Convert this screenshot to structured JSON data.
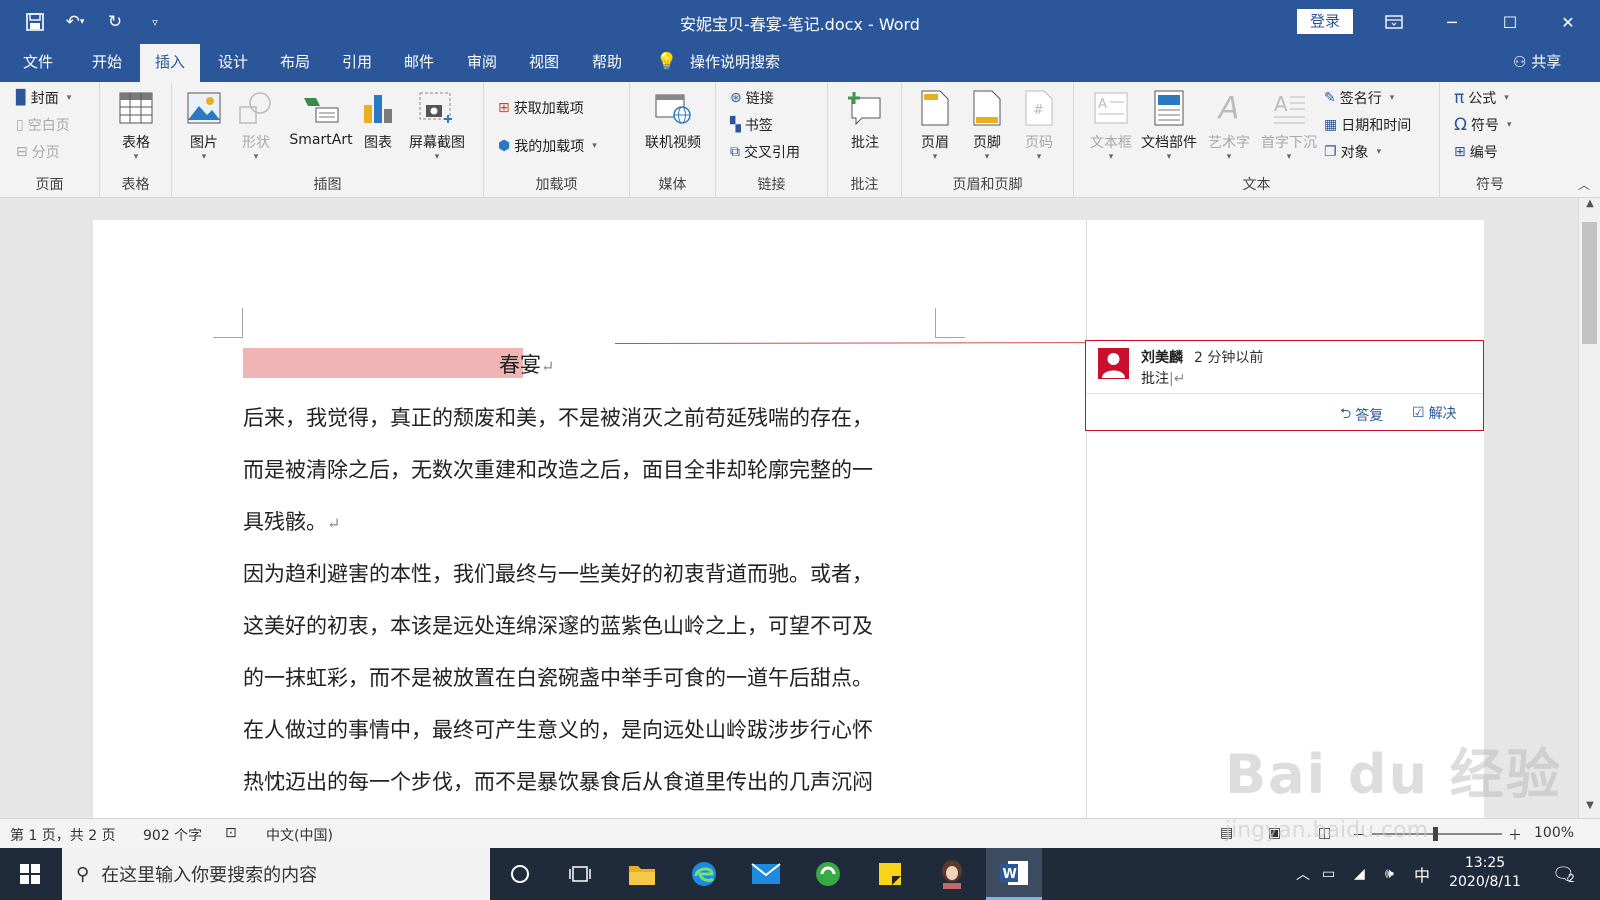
{
  "window": {
    "title": "安妮宝贝-春宴-笔记.docx  -  Word",
    "login_label": "登录"
  },
  "menu": {
    "tabs": [
      "文件",
      "开始",
      "插入",
      "设计",
      "布局",
      "引用",
      "邮件",
      "审阅",
      "视图",
      "帮助"
    ],
    "active_tab": "插入",
    "tell_me": "操作说明搜索",
    "share": "共享"
  },
  "ribbon": {
    "page": {
      "label": "页面",
      "cover": "封面",
      "blank": "空白页",
      "break": "分页"
    },
    "table": {
      "label": "表格",
      "table": "表格"
    },
    "illustrations": {
      "label": "插图",
      "picture": "图片",
      "shapes": "形状",
      "smartart": "SmartArt",
      "chart": "图表",
      "screenshot": "屏幕截图"
    },
    "addins": {
      "label": "加载项",
      "get": "获取加载项",
      "mine": "我的加载项"
    },
    "media": {
      "label": "媒体",
      "online_video": "联机视频"
    },
    "links": {
      "label": "链接",
      "link": "链接",
      "bookmark": "书签",
      "crossref": "交叉引用"
    },
    "comments": {
      "label": "批注",
      "comment": "批注"
    },
    "header_footer": {
      "label": "页眉和页脚",
      "header": "页眉",
      "footer": "页脚",
      "page_number": "页码"
    },
    "text": {
      "label": "文本",
      "textbox": "文本框",
      "quickparts": "文档部件",
      "wordart": "艺术字",
      "dropcap": "首字下沉",
      "signature": "签名行",
      "datetime": "日期和时间",
      "object": "对象"
    },
    "symbols": {
      "label": "符号",
      "equation": "公式",
      "symbol": "符号",
      "number": "编号"
    }
  },
  "document": {
    "title": "春宴",
    "lines": [
      "后来，我觉得，真正的颓废和美，不是被消灭之前苟延残喘的存在，",
      "而是被清除之后，无数次重建和改造之后，面目全非却轮廓完整的一",
      "具残骸。",
      "因为趋利避害的本性，我们最终与一些美好的初衷背道而驰。或者，",
      "这美好的初衷，本该是远处连绵深邃的蓝紫色山岭之上，可望不可及",
      "的一抹虹彩，而不是被放置在白瓷碗盏中举手可食的一道午后甜点。",
      "在人做过的事情中，最终可产生意义的，是向远处山岭跋涉步行心怀",
      "热忱迈出的每一个步伐，而不是暴饮暴食后从食道里传出的几声沉闷"
    ]
  },
  "comment": {
    "author": "刘美麟",
    "time": "2 分钟以前",
    "text": "批注",
    "reply": "答复",
    "resolve": "解决"
  },
  "status": {
    "page": "第 1 页，共 2 页",
    "words": "902 个字",
    "language": "中文(中国)",
    "zoom": "100%"
  },
  "taskbar": {
    "search_placeholder": "在这里输入你要搜索的内容",
    "ime": "中",
    "time": "13:25",
    "date": "2020/8/11",
    "notifications": "2"
  },
  "watermark": {
    "logo_text": "Bai du 经验",
    "url": "jingyan.baidu.com"
  },
  "colors": {
    "accent": "#2b579a",
    "title_highlight": "#f0b4b4",
    "comment_border": "#c8102e"
  }
}
